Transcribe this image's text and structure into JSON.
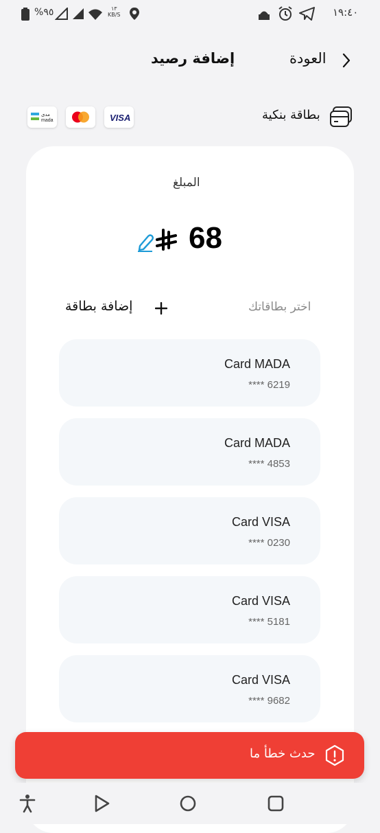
{
  "status_bar": {
    "time": "١٩:٤٠",
    "battery": "%٩٥",
    "speed_value": "١٣",
    "speed_unit": "KB/S"
  },
  "header": {
    "back_label": "العودة",
    "title": "إضافة رصيد"
  },
  "payment": {
    "bank_card_label": "بطاقة بنكية",
    "logos": [
      "visa-logo",
      "mastercard-logo",
      "mada-logo"
    ]
  },
  "amount": {
    "label": "المبلغ",
    "value": "68"
  },
  "cards_section": {
    "choose_label": "اختر بطاقاتك",
    "add_card_label": "إضافة بطاقة"
  },
  "cards": [
    {
      "name": "Card MADA",
      "number": "**** 6219"
    },
    {
      "name": "Card MADA",
      "number": "**** 4853"
    },
    {
      "name": "Card VISA",
      "number": "**** 0230"
    },
    {
      "name": "Card VISA",
      "number": "**** 5181"
    },
    {
      "name": "Card VISA",
      "number": "**** 9682"
    }
  ],
  "toast": {
    "message": "حدث خطأ ما"
  },
  "colors": {
    "accent": "#ef3f35",
    "card_bg": "#f4f7fa",
    "page_bg": "#f3f3f5",
    "edit_icon": "#1e9bd7"
  }
}
